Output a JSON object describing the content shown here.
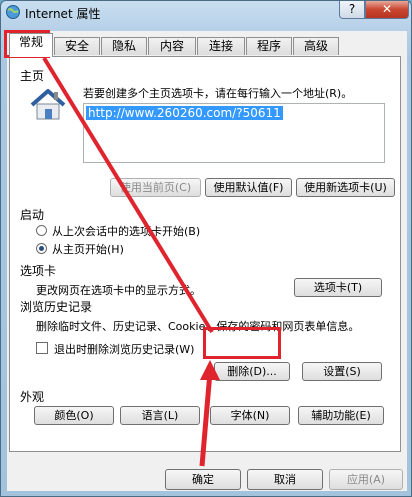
{
  "window": {
    "title": "Internet 属性",
    "help_label": "?",
    "close_label": "✕"
  },
  "tabs": [
    "常规",
    "安全",
    "隐私",
    "内容",
    "连接",
    "程序",
    "高级"
  ],
  "home": {
    "group_label": "主页",
    "hint": "若要创建多个主页选项卡，请在每行输入一个地址(R)。",
    "url": "http://www.260260.com/?50611",
    "use_current": "使用当前页(C)",
    "use_default": "使用默认值(F)",
    "use_new_tab": "使用新选项卡(U)"
  },
  "startup": {
    "group_label": "启动",
    "option_last": "从上次会话中的选项卡开始(B)",
    "option_home": "从主页开始(H)"
  },
  "tabs_section": {
    "group_label": "选项卡",
    "hint": "更改网页在选项卡中的显示方式。",
    "button": "选项卡(T)"
  },
  "history": {
    "group_label": "浏览历史记录",
    "hint": "删除临时文件、历史记录、Cookie、保存的密码和网页表单信息。",
    "checkbox_label": "退出时删除浏览历史记录(W)",
    "delete_button": "删除(D)...",
    "settings_button": "设置(S)"
  },
  "appearance": {
    "group_label": "外观",
    "colors": "颜色(O)",
    "languages": "语言(L)",
    "fonts": "字体(N)",
    "accessibility": "辅助功能(E)"
  },
  "footer": {
    "ok": "确定",
    "cancel": "取消",
    "apply": "应用(A)"
  },
  "colors": {
    "annotation_red": "#e0242e",
    "selection_blue": "#3399ff",
    "close_red": "#c94630"
  }
}
